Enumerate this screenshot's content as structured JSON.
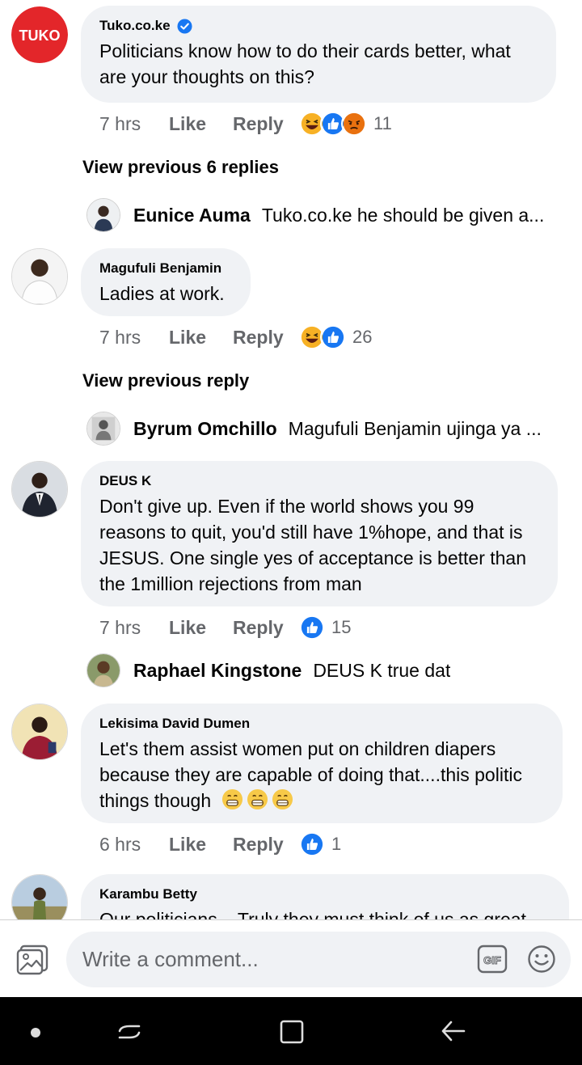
{
  "comments": [
    {
      "author": "Tuko.co.ke",
      "verified": true,
      "text": "Politicians know how to do their cards better, what are your thoughts on this?",
      "time": "7 hrs",
      "like_label": "Like",
      "reply_label": "Reply",
      "reaction_count": "11",
      "reactions": [
        "haha",
        "like",
        "angry"
      ],
      "view_previous": "View previous 6 replies",
      "latest_reply": {
        "author": "Eunice Auma",
        "text": "Tuko.co.ke he should be given a..."
      }
    },
    {
      "author": "Magufuli Benjamin",
      "text": "Ladies at work.",
      "time": "7 hrs",
      "like_label": "Like",
      "reply_label": "Reply",
      "reaction_count": "26",
      "reactions": [
        "haha",
        "like"
      ],
      "view_previous": "View previous reply",
      "latest_reply": {
        "author": "Byrum Omchillo",
        "text": "Magufuli Benjamin ujinga ya ..."
      }
    },
    {
      "author": "DEUS K",
      "text": "Don't give up. Even if the world shows you 99 reasons to quit, you'd still have 1%hope, and that is JESUS. One single yes of acceptance is better than the 1million rejections from man",
      "time": "7 hrs",
      "like_label": "Like",
      "reply_label": "Reply",
      "reaction_count": "15",
      "reactions": [
        "like"
      ],
      "latest_reply": {
        "author": "Raphael Kingstone",
        "text": "DEUS K true dat"
      }
    },
    {
      "author": "Lekisima David Dumen",
      "text": "Let's them assist women put on children diapers because they are capable of doing that....this politic things though",
      "time": "6 hrs",
      "like_label": "Like",
      "reply_label": "Reply",
      "reaction_count": "1",
      "reactions": [
        "like"
      ]
    },
    {
      "author": "Karambu Betty",
      "text": "Our politicians... Truly they must think of us as great"
    }
  ],
  "avatar_logo_text": "TUKO",
  "composer": {
    "placeholder": "Write a comment...",
    "gif_label": "GIF"
  },
  "colors": {
    "bubble_bg": "#f0f2f5",
    "meta_text": "#65676b",
    "like_blue": "#1877f2",
    "haha_yellow": "#f7b125",
    "angry_orange": "#e9710f",
    "tuko_red": "#e3262a"
  },
  "icons": [
    "verified-badge-icon",
    "photo-icon",
    "gif-icon",
    "emoji-icon",
    "recent-apps-icon",
    "home-icon",
    "back-icon"
  ]
}
